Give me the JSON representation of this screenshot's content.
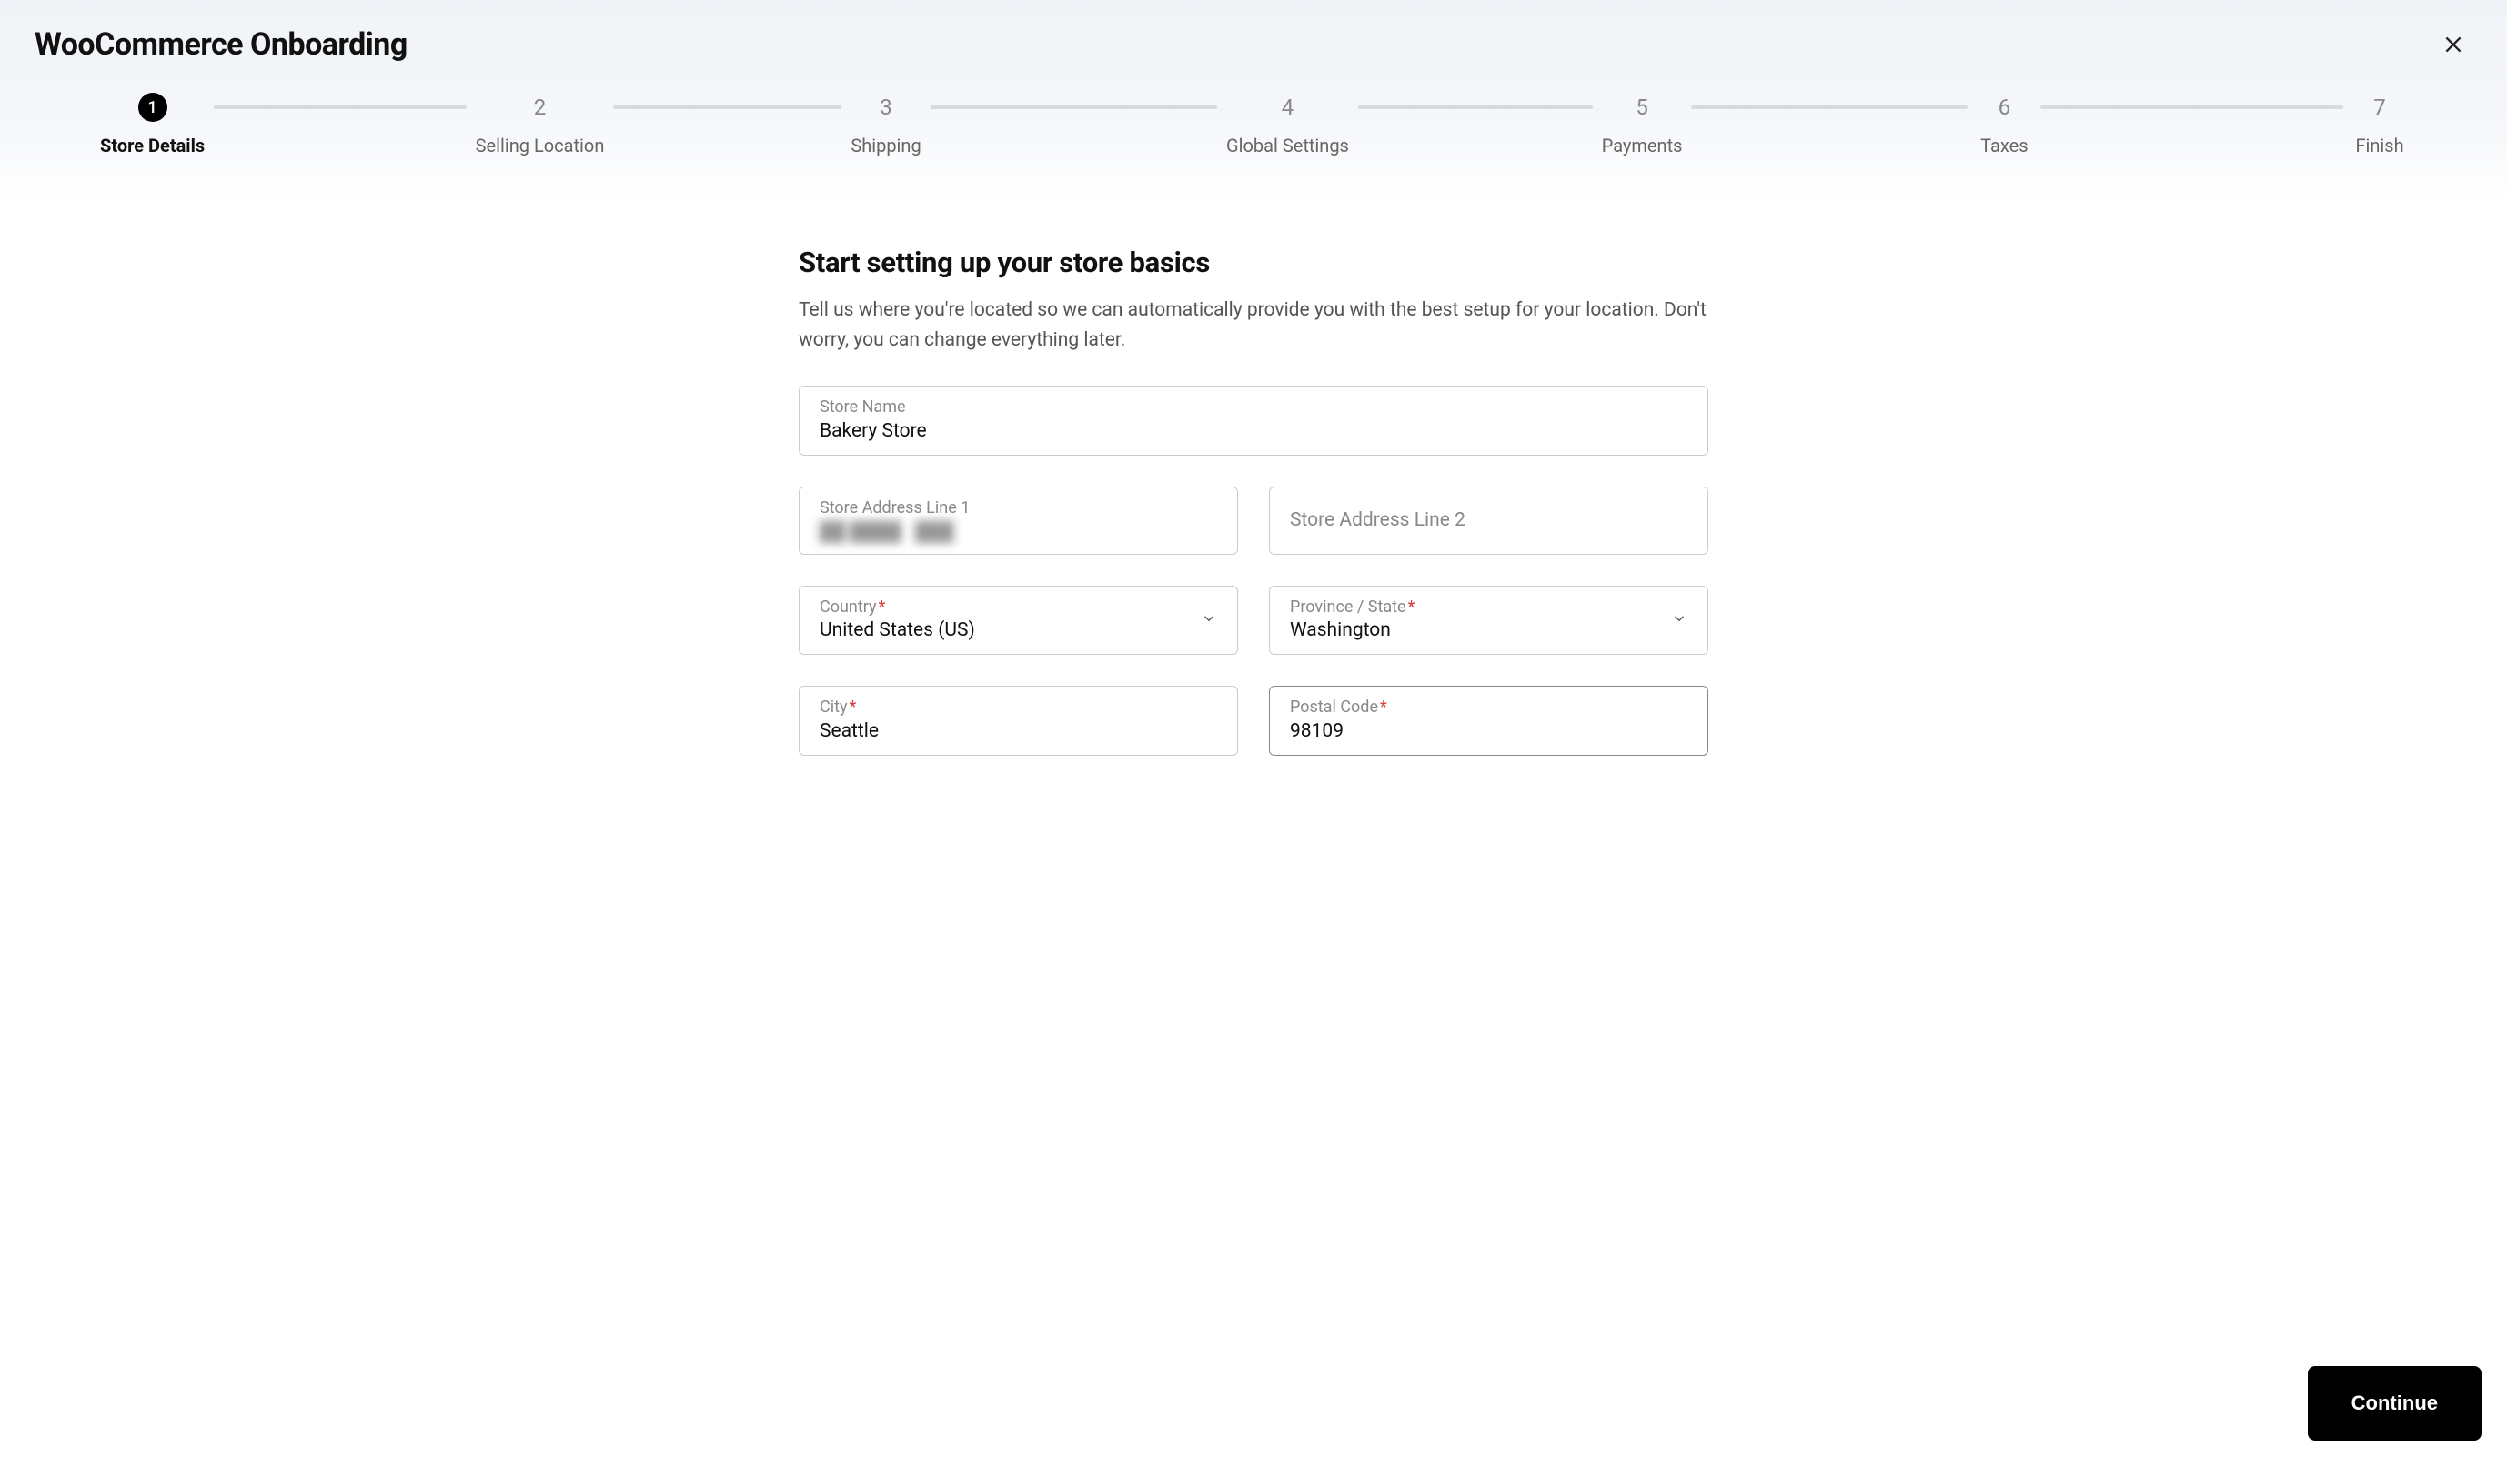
{
  "header": {
    "title": "WooCommerce Onboarding"
  },
  "stepper": {
    "active_index": 0,
    "steps": [
      {
        "num": "1",
        "label": "Store Details"
      },
      {
        "num": "2",
        "label": "Selling Location"
      },
      {
        "num": "3",
        "label": "Shipping"
      },
      {
        "num": "4",
        "label": "Global Settings"
      },
      {
        "num": "5",
        "label": "Payments"
      },
      {
        "num": "6",
        "label": "Taxes"
      },
      {
        "num": "7",
        "label": "Finish"
      }
    ]
  },
  "form": {
    "heading": "Start setting up your store basics",
    "subheading": "Tell us where you're located so we can automatically provide you with the best setup for your location. Don't worry, you can change everything later.",
    "store_name": {
      "label": "Store Name",
      "value": "Bakery Store"
    },
    "addr1": {
      "label": "Store Address Line 1",
      "value_obscured": true
    },
    "addr2": {
      "label": "Store Address Line 2",
      "value": ""
    },
    "country": {
      "label": "Country",
      "required": true,
      "value": "United States (US)"
    },
    "province": {
      "label": "Province / State",
      "required": true,
      "value": "Washington"
    },
    "city": {
      "label": "City",
      "required": true,
      "value": "Seattle"
    },
    "postal": {
      "label": "Postal Code",
      "required": true,
      "value": "98109"
    }
  },
  "footer": {
    "continue_label": "Continue"
  }
}
